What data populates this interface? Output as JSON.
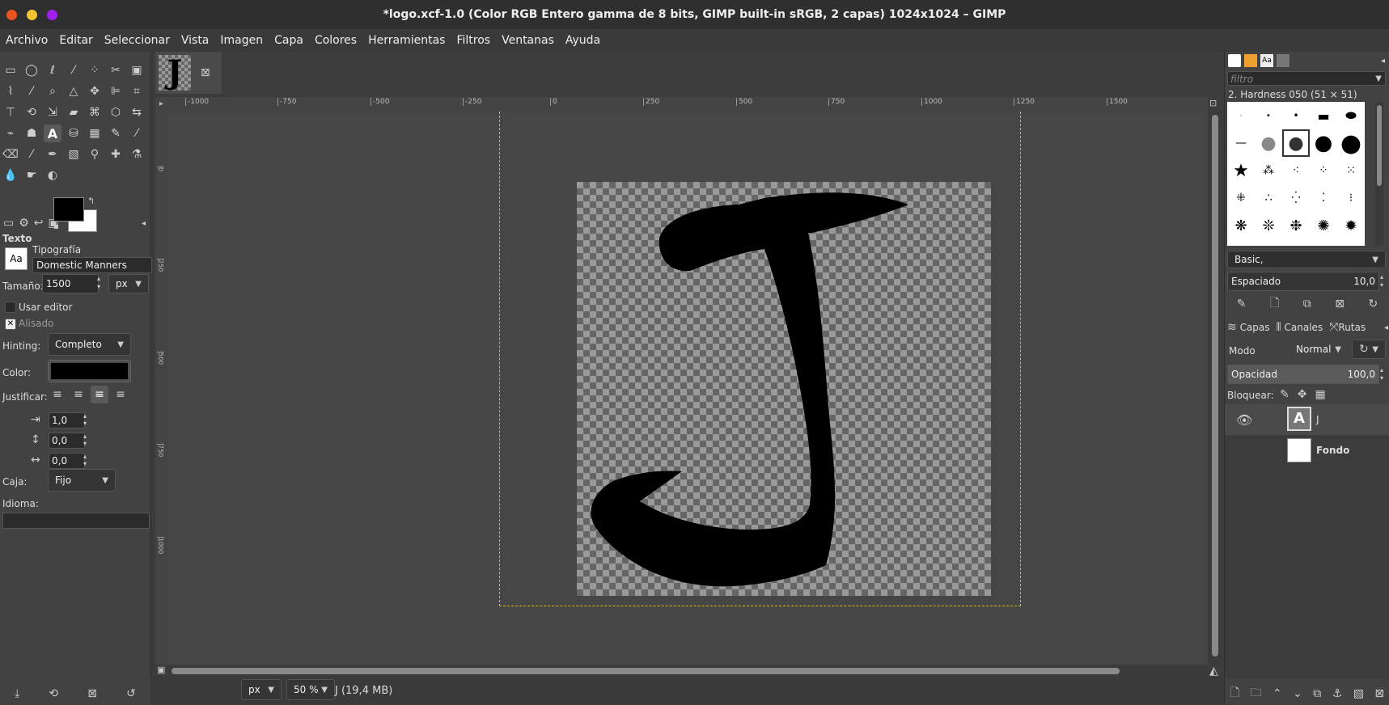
{
  "window": {
    "title": "*logo.xcf-1.0 (Color RGB Entero gamma de 8 bits, GIMP built-in sRGB, 2 capas) 1024x1024 – GIMP"
  },
  "menu": [
    "Archivo",
    "Editar",
    "Seleccionar",
    "Vista",
    "Imagen",
    "Capa",
    "Colores",
    "Herramientas",
    "Filtros",
    "Ventanas",
    "Ayuda"
  ],
  "tool_options": {
    "header": "Texto",
    "font_label": "Tipografía",
    "font_value": "Domestic Manners",
    "size_label": "Tamaño:",
    "size_value": "1500",
    "size_unit": "px",
    "use_editor": "Usar editor",
    "antialias": "Alisado",
    "hinting_label": "Hinting:",
    "hinting_value": "Completo",
    "color_label": "Color:",
    "justify_label": "Justificar:",
    "indent_value": "1,0",
    "line_spacing_value": "0,0",
    "letter_spacing_value": "0,0",
    "box_label": "Caja:",
    "box_value": "Fijo",
    "language_label": "Idioma:"
  },
  "ruler": {
    "h_ticks": [
      "-1000",
      "-750",
      "-500",
      "-250",
      "0",
      "250",
      "500",
      "750",
      "1000",
      "1250",
      "1500"
    ],
    "v_ticks": [
      "0",
      "250",
      "500",
      "750",
      "1000"
    ]
  },
  "status": {
    "unit": "px",
    "zoom": "50 %",
    "layer_info": "J (19,4 MB)"
  },
  "brushes": {
    "filter_placeholder": "filtro",
    "selected": "2. Hardness 050 (51 × 51)",
    "tag": "Basic,",
    "spacing_label": "Espaciado",
    "spacing_value": "10,0"
  },
  "layers_panel": {
    "tabs": [
      "Capas",
      "Canales",
      "Rutas"
    ],
    "mode_label": "Modo",
    "mode_value": "Normal",
    "opacity_label": "Opacidad",
    "opacity_value": "100,0",
    "lock_label": "Bloquear:",
    "layers": [
      {
        "name": "J",
        "visible": true
      },
      {
        "name": "Fondo",
        "visible": false
      }
    ]
  },
  "colors": {
    "foreground": "#000000",
    "background": "#ffffff",
    "text_color": "#000000"
  },
  "glyph": "J"
}
